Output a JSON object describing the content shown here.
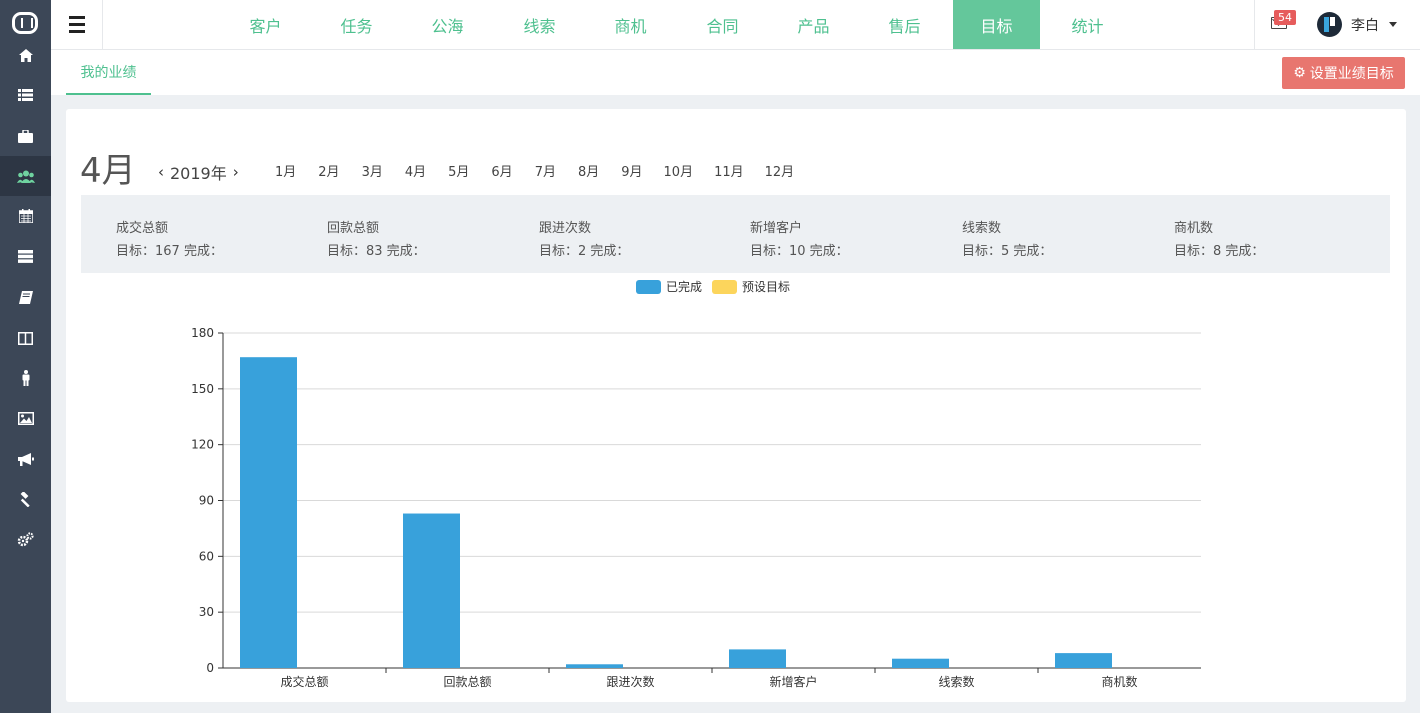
{
  "sidebar": {
    "items": [
      {
        "name": "home-icon",
        "icon": "home"
      },
      {
        "name": "list-icon",
        "icon": "list"
      },
      {
        "name": "briefcase-icon",
        "icon": "briefcase"
      },
      {
        "name": "users-icon",
        "icon": "users",
        "active": true
      },
      {
        "name": "calendar-icon",
        "icon": "calendar"
      },
      {
        "name": "server-icon",
        "icon": "server"
      },
      {
        "name": "book-icon",
        "icon": "book"
      },
      {
        "name": "columns-icon",
        "icon": "columns"
      },
      {
        "name": "person-icon",
        "icon": "person"
      },
      {
        "name": "image-icon",
        "icon": "image"
      },
      {
        "name": "bullhorn-icon",
        "icon": "bullhorn"
      },
      {
        "name": "gavel-icon",
        "icon": "gavel"
      },
      {
        "name": "gears-icon",
        "icon": "gears"
      }
    ]
  },
  "nav": {
    "tabs": [
      "客户",
      "任务",
      "公海",
      "线索",
      "商机",
      "合同",
      "产品",
      "售后",
      "目标",
      "统计"
    ],
    "active_tab": "目标"
  },
  "user": {
    "mail_count": "54",
    "name": "李白"
  },
  "subheader": {
    "tab": "我的业绩",
    "set_button": "设置业绩目标"
  },
  "period": {
    "month": "4月",
    "year": "2019年",
    "months": [
      "1月",
      "2月",
      "3月",
      "4月",
      "5月",
      "6月",
      "7月",
      "8月",
      "9月",
      "10月",
      "11月",
      "12月"
    ]
  },
  "stats": [
    {
      "label": "成交总额",
      "detail": "目标：167 完成："
    },
    {
      "label": "回款总额",
      "detail": "目标：83 完成："
    },
    {
      "label": "跟进次数",
      "detail": "目标：2 完成："
    },
    {
      "label": "新增客户",
      "detail": "目标：10 完成："
    },
    {
      "label": "线索数",
      "detail": "目标：5 完成："
    },
    {
      "label": "商机数",
      "detail": "目标：8 完成："
    }
  ],
  "colors": {
    "accent": "#4ec08f",
    "active_tab_bg": "#64c79b",
    "button_red": "#e8766f",
    "sidebar": "#3c4757",
    "series_done": "#38a1db",
    "series_target": "#fcd55c"
  },
  "chart_data": {
    "type": "bar",
    "categories": [
      "成交总额",
      "回款总额",
      "跟进次数",
      "新增客户",
      "线索数",
      "商机数"
    ],
    "series": [
      {
        "name": "已完成",
        "values": [
          167,
          83,
          2,
          10,
          5,
          8
        ]
      },
      {
        "name": "预设目标",
        "values": [
          0,
          0,
          0,
          0,
          0,
          0
        ]
      }
    ],
    "ylim": [
      0,
      180
    ],
    "yticks": [
      0,
      30,
      60,
      90,
      120,
      150,
      180
    ],
    "grid": true,
    "legend": "top-center"
  }
}
